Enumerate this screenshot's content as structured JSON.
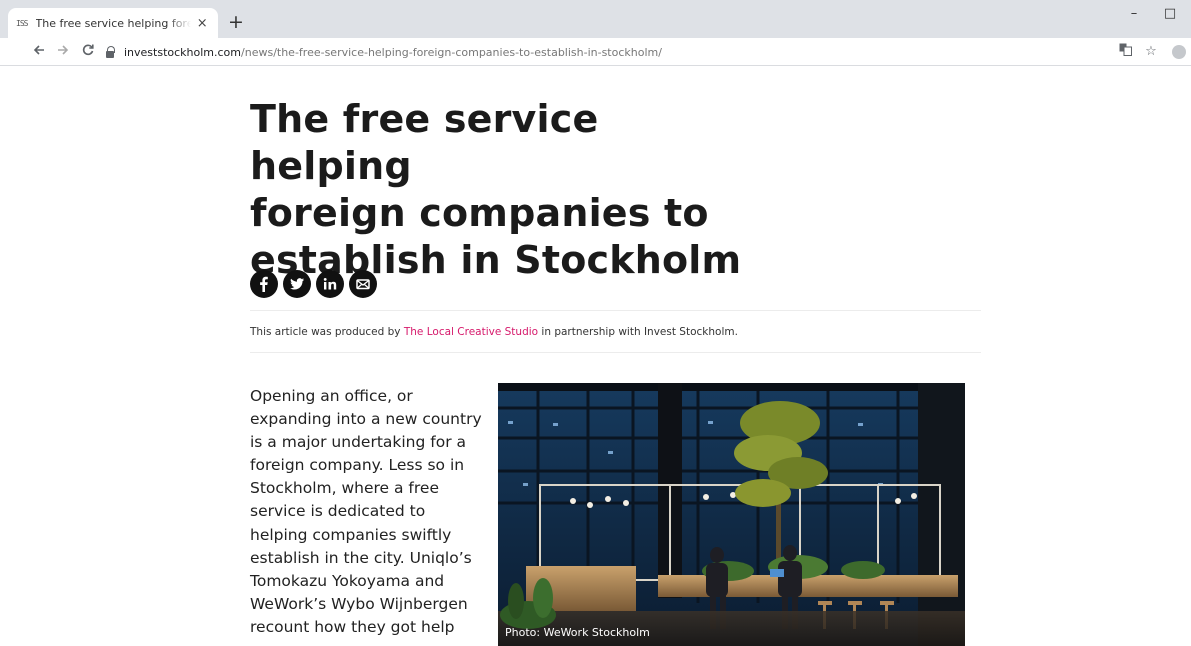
{
  "browser": {
    "tab": {
      "favicon": "ISS",
      "title": "The free service helping foreign companies to establish in Stockholm",
      "close": "×"
    },
    "new_tab": "+",
    "window_controls": {
      "minimize": "–",
      "maximize": "□"
    },
    "url": {
      "host": "investstockholm.com",
      "path": "/news/the-free-service-helping-foreign-companies-to-establish-in-stockholm/"
    },
    "icons": [
      "back-arrow-icon",
      "forward-arrow-icon",
      "reload-icon",
      "lock-icon",
      "translate-icon",
      "bookmark-star-icon",
      "profile-avatar-icon"
    ]
  },
  "article": {
    "headline_lines": [
      "The free service helping",
      "foreign companies to",
      "establish in Stockholm"
    ],
    "share": [
      "facebook-icon",
      "twitter-icon",
      "linkedin-icon",
      "email-icon"
    ],
    "credit": {
      "prefix": "This article was produced by ",
      "link": "The Local Creative Studio",
      "suffix": " in partnership with Invest Stockholm."
    },
    "lede_lines": [
      "Opening an office, or",
      "expanding into a new country",
      "is a major undertaking for a",
      "foreign company. Less so in",
      "Stockholm, where a free",
      "service is dedicated to",
      "helping companies swiftly",
      "establish in the city. Uniqlo’s",
      "Tomokazu Yokoyama and",
      "WeWork’s Wybo Wijnbergen",
      "recount how they got help"
    ],
    "photo": {
      "caption": "Photo: WeWork Stockholm"
    },
    "colors": {
      "link": "#d6196b",
      "text": "#1b1b1b"
    }
  }
}
